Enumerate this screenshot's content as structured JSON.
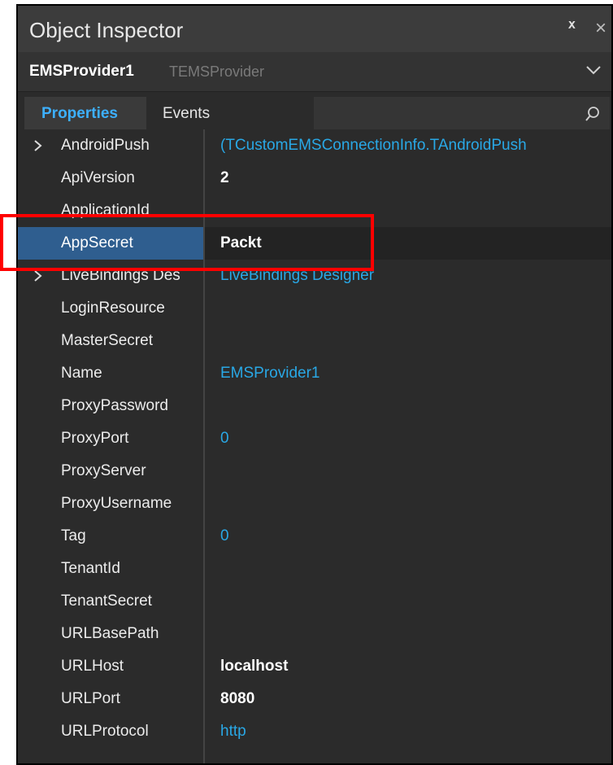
{
  "window": {
    "title": "Object Inspector",
    "pin_glyph": "ᕁ",
    "close_glyph": "×"
  },
  "selector": {
    "object_name": "EMSProvider1",
    "class_name": "TEMSProvider"
  },
  "tabs": [
    {
      "label": "Properties",
      "active": true
    },
    {
      "label": "Events",
      "active": false
    }
  ],
  "properties": [
    {
      "name": "AndroidPush",
      "value": "(TCustomEMSConnectionInfo.TAndroidPush",
      "expandable": true,
      "style": "link"
    },
    {
      "name": "ApiVersion",
      "value": "2",
      "style": "bold"
    },
    {
      "name": "ApplicationId",
      "value": "",
      "style": ""
    },
    {
      "name": "AppSecret",
      "value": "Packt",
      "style": "bold",
      "selected": true
    },
    {
      "name": "LiveBindings Des",
      "value": "LiveBindings Designer",
      "expandable": true,
      "style": "link"
    },
    {
      "name": "LoginResource",
      "value": "",
      "style": ""
    },
    {
      "name": "MasterSecret",
      "value": "",
      "style": ""
    },
    {
      "name": "Name",
      "value": "EMSProvider1",
      "style": "link"
    },
    {
      "name": "ProxyPassword",
      "value": "",
      "style": ""
    },
    {
      "name": "ProxyPort",
      "value": "0",
      "style": "num"
    },
    {
      "name": "ProxyServer",
      "value": "",
      "style": ""
    },
    {
      "name": "ProxyUsername",
      "value": "",
      "style": ""
    },
    {
      "name": "Tag",
      "value": "0",
      "style": "num"
    },
    {
      "name": "TenantId",
      "value": "",
      "style": ""
    },
    {
      "name": "TenantSecret",
      "value": "",
      "style": ""
    },
    {
      "name": "URLBasePath",
      "value": "",
      "style": ""
    },
    {
      "name": "URLHost",
      "value": "localhost",
      "style": "bold"
    },
    {
      "name": "URLPort",
      "value": "8080",
      "style": "bold"
    },
    {
      "name": "URLProtocol",
      "value": "http",
      "style": "link"
    }
  ],
  "colors": {
    "background": "#2b2b2b",
    "selected_row": "#2f5e8f",
    "accent": "#29a8e6",
    "annotation": "#ff0000"
  },
  "icons": [
    "pin-icon",
    "close-icon",
    "chevron-down-icon",
    "search-icon",
    "expand-arrow-icon"
  ]
}
